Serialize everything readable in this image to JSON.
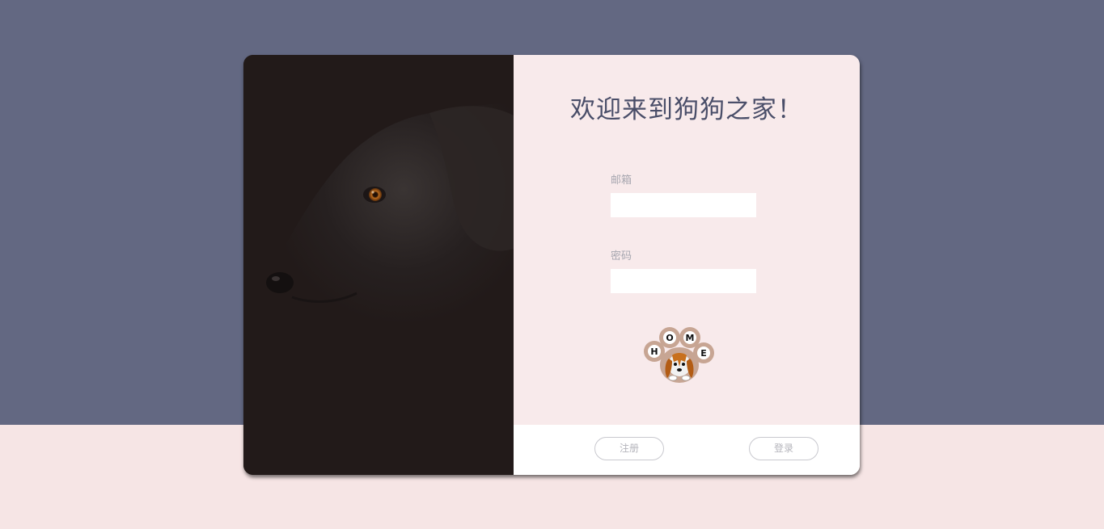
{
  "login": {
    "title": "欢迎来到狗狗之家！",
    "email_label": "邮箱",
    "email_value": "",
    "password_label": "密码",
    "password_value": "",
    "logo_letters": [
      "H",
      "O",
      "M",
      "E"
    ],
    "register_label": "注册",
    "login_label": "登录"
  },
  "colors": {
    "background_top": "#636882",
    "background_bottom": "#f6e5e5",
    "form_panel": "#f8eaeb",
    "title": "#4a4e69"
  }
}
